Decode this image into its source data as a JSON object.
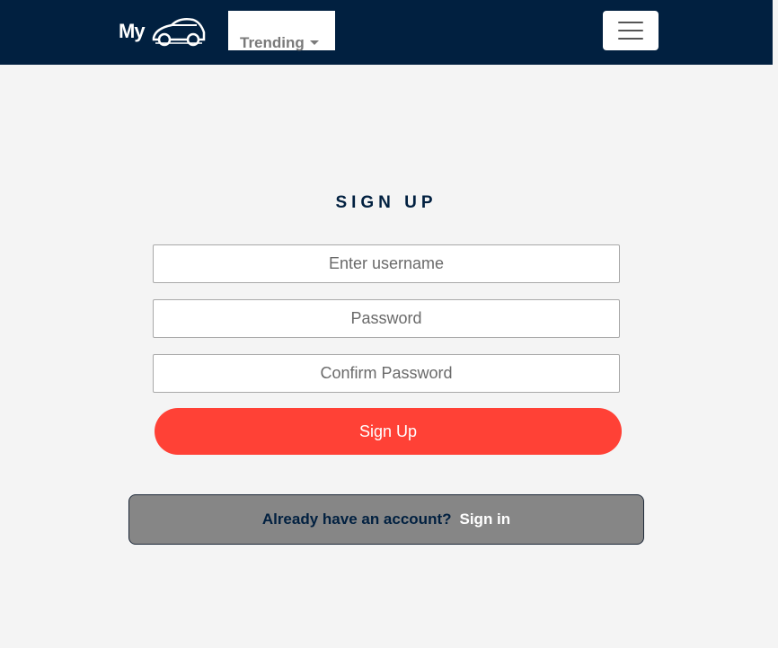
{
  "navbar": {
    "logo_text": "My",
    "logo_icon": "car-icon",
    "trending_label": "Trending",
    "menu_icon": "hamburger-menu-icon",
    "background_color": "#012040"
  },
  "form": {
    "title": "SIGN UP",
    "username_placeholder": "Enter username",
    "password_placeholder": "Password",
    "confirm_placeholder": "Confirm Password",
    "submit_label": "Sign Up",
    "submit_color": "#ff4136"
  },
  "footer_box": {
    "prompt": "Already have an account?",
    "link_label": "Sign in"
  }
}
